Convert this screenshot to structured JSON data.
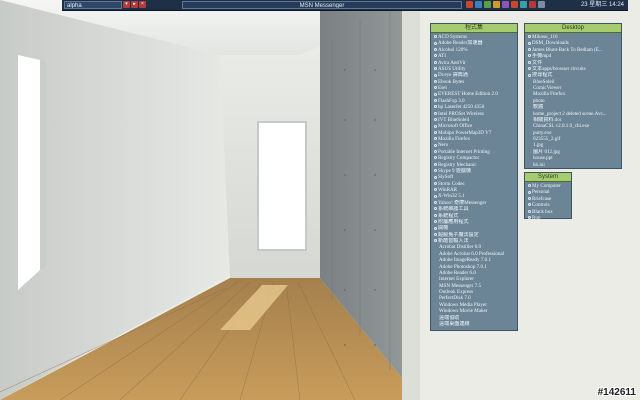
{
  "taskbar": {
    "task_left": "alpha",
    "task_center": "MSN Messenger",
    "clock": "23 星期三 14:24"
  },
  "colors": {
    "taskbar": "#1f2f46",
    "panel_bg": "#6b8496",
    "panel_title_bg": "#a7cc6f",
    "wall": "#dfe2dd",
    "floor": "#b4894e",
    "concrete": "#868b8c"
  },
  "programs_panel": {
    "title": "程式集",
    "items": [
      {
        "label": "ACD Systems"
      },
      {
        "label": "Adobe Reader加速器"
      },
      {
        "label": "Alcohol 120%"
      },
      {
        "label": "ATI"
      },
      {
        "label": "Avira AntiVir"
      },
      {
        "label": "ASUS Utility"
      },
      {
        "label": "Dr.eye 譯典通"
      },
      {
        "label": "Ebook Bytes"
      },
      {
        "label": "Esel"
      },
      {
        "label": "EVEREST Home Edition 2.0"
      },
      {
        "label": "FlashFxp 3.0"
      },
      {
        "label": "hp LaserJet 4250 4350"
      },
      {
        "label": "Intel PROSet Wireless"
      },
      {
        "label": "IVT BlueSoleil"
      },
      {
        "label": "Microsoft Office"
      },
      {
        "label": "Mobipo PowerMap3D V7"
      },
      {
        "label": "Mozilla Firefox"
      },
      {
        "label": "Nero"
      },
      {
        "label": "Portable Internet Printing"
      },
      {
        "label": "Registry Compactor"
      },
      {
        "label": "Registry Mechanic"
      },
      {
        "label": "Skype 9 遊戲機"
      },
      {
        "label": "SlySoft"
      },
      {
        "label": "Storm Codec"
      },
      {
        "label": "WinRAR"
      },
      {
        "label": "X-Win32 5.1"
      },
      {
        "label": "Yahoo! 奇摩Messenger"
      },
      {
        "label": "系統維護工具"
      },
      {
        "label": "系統程式"
      },
      {
        "label": "附屬應用程式"
      },
      {
        "label": "開機"
      },
      {
        "label": "超級兔子魔法設定"
      },
      {
        "label": "新酷音輸入法"
      },
      {
        "label": "Acrobat Distiller 6.0",
        "indent": true
      },
      {
        "label": "Adobe Acrobat 6.0 Professional",
        "indent": true
      },
      {
        "label": "Adobe ImageReady 7.0.1",
        "indent": true
      },
      {
        "label": "Adobe Photoshop 7.0.1",
        "indent": true
      },
      {
        "label": "Adobe Reader 6.0",
        "indent": true
      },
      {
        "label": "Internet Explorer",
        "indent": true
      },
      {
        "label": "MSN Messenger 7.5",
        "indent": true
      },
      {
        "label": "Outlook Express",
        "indent": true
      },
      {
        "label": "PerfectDisk 7.0",
        "indent": true
      },
      {
        "label": "Windows Media Player",
        "indent": true
      },
      {
        "label": "Windows Movie Maker",
        "indent": true
      },
      {
        "label": "遠端協助",
        "indent": true
      },
      {
        "label": "遠端桌面連線",
        "indent": true
      }
    ]
  },
  "desktop_panel": {
    "title": "Desktop",
    "items": [
      {
        "label": "Mikosu_116"
      },
      {
        "label": "DSM_Downloads"
      },
      {
        "label": "James Blunt-Back To Bedlam (E..."
      },
      {
        "label": "手機mp4"
      },
      {
        "label": "文件"
      },
      {
        "label": "文本apps/browser circuits"
      },
      {
        "label": "搜尋程式"
      },
      {
        "label": "BlueSoleil",
        "indent": true
      },
      {
        "label": "ComicViewer",
        "indent": true
      },
      {
        "label": "Mozilla Firefox",
        "indent": true
      },
      {
        "label": "photo",
        "indent": true
      },
      {
        "label": "軟體",
        "indent": true
      },
      {
        "label": "home_project 2 deleted scene.Avc...",
        "indent": true
      },
      {
        "label": "相關資料.doc",
        "indent": true
      },
      {
        "label": "ChinaCSL v2.0.1.0_chi.exe",
        "indent": true
      },
      {
        "label": "putty.exe",
        "indent": true
      },
      {
        "label": "023555_2.gif",
        "indent": true
      },
      {
        "label": "1.jpg",
        "indent": true
      },
      {
        "label": "圖片 012.jpg",
        "indent": true
      },
      {
        "label": "house.ppt",
        "indent": true
      },
      {
        "label": "hh.ini",
        "indent": true
      }
    ]
  },
  "system_panel": {
    "title": "System",
    "items": [
      {
        "label": "My Computer"
      },
      {
        "label": "Personal"
      },
      {
        "label": "Briefcase"
      },
      {
        "label": "Controls"
      },
      {
        "label": "Black box"
      },
      {
        "label": "Run"
      }
    ]
  },
  "watermark": "#142611"
}
